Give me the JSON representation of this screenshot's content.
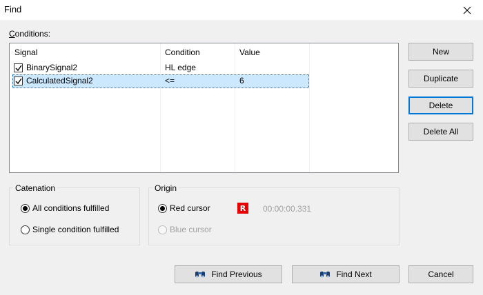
{
  "window": {
    "title": "Find"
  },
  "conditions": {
    "label": "Conditions:",
    "columns": [
      "Signal",
      "Condition",
      "Value"
    ],
    "rows": [
      {
        "checked": true,
        "signal": "BinarySignal2",
        "condition": "HL edge",
        "value": ""
      },
      {
        "checked": true,
        "signal": "CalculatedSignal2",
        "condition": "<=",
        "value": "6"
      }
    ]
  },
  "side_buttons": {
    "new_label": "New",
    "duplicate_label": "Duplicate",
    "delete_label": "Delete",
    "delete_all_label": "Delete All"
  },
  "catenation": {
    "title": "Catenation",
    "options": [
      "All conditions fulfilled",
      "Single condition fulfilled"
    ],
    "selected": "All conditions fulfilled"
  },
  "origin": {
    "title": "Origin",
    "red_cursor_label": "Red cursor",
    "red_badge": "R",
    "red_time": "00:00:00.331",
    "blue_cursor_label": "Blue cursor",
    "selected": "Red cursor"
  },
  "footer_buttons": {
    "find_previous_label": "Find Previous",
    "find_next_label": "Find Next",
    "cancel_label": "Cancel"
  },
  "colors": {
    "selection": "#cce8ff",
    "focus": "#0078d7",
    "red_badge": "#e60000"
  },
  "icons": [
    "close-icon",
    "checkmark-icon",
    "binoculars-icon",
    "radio-dot-icon"
  ]
}
